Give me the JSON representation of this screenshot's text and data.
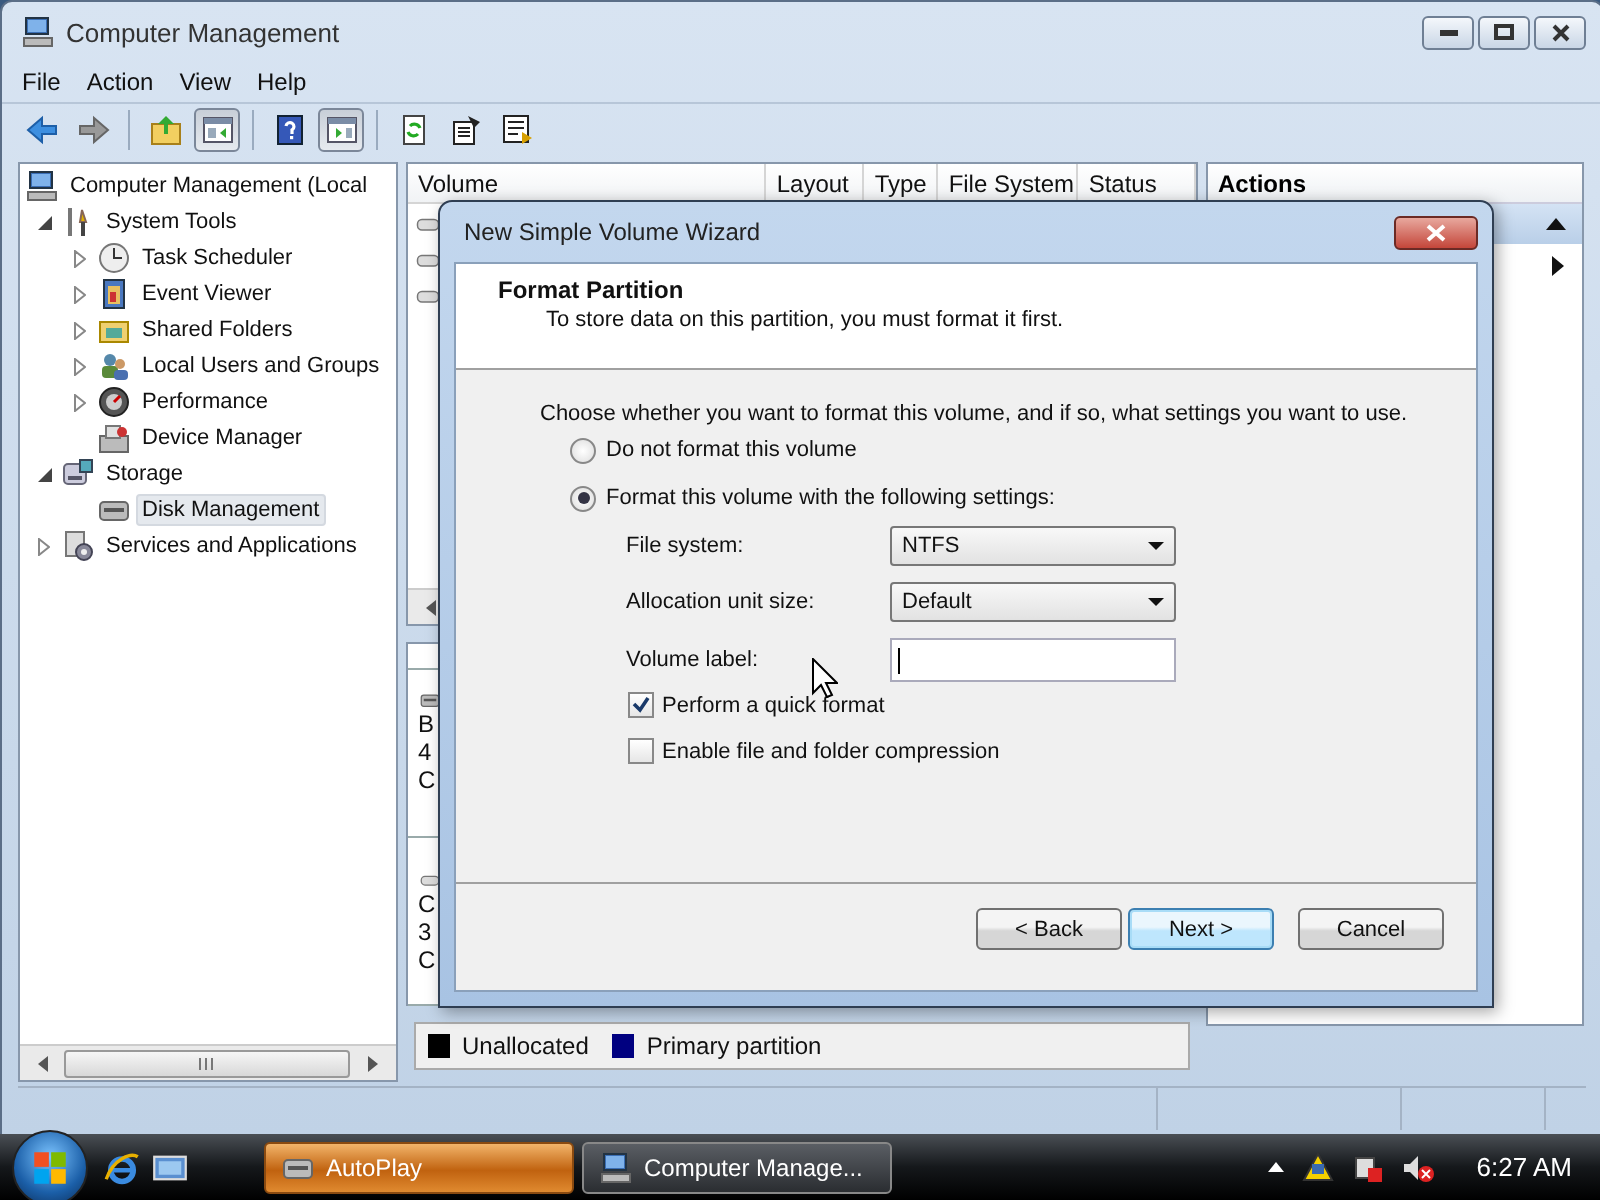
{
  "window": {
    "title": "Computer Management"
  },
  "menu": [
    "File",
    "Action",
    "View",
    "Help"
  ],
  "toolbar": [
    [
      {
        "kind": "back",
        "pressed": false
      },
      {
        "kind": "forward",
        "pressed": false
      }
    ],
    [
      {
        "kind": "up",
        "pressed": false
      },
      {
        "kind": "tree",
        "pressed": true
      }
    ],
    [
      {
        "kind": "help",
        "pressed": false
      },
      {
        "kind": "panel",
        "pressed": true
      }
    ],
    [
      {
        "kind": "refresh",
        "pressed": false
      },
      {
        "kind": "properties",
        "pressed": false
      },
      {
        "kind": "export",
        "pressed": false
      }
    ]
  ],
  "tree": [
    {
      "label": "Computer Management (Local",
      "kind": "leaf",
      "selected": false,
      "children": [
        {
          "label": "System Tools",
          "kind": "branch",
          "expanded": true,
          "selected": false,
          "children": [
            {
              "label": "Task Scheduler",
              "kind": "branch",
              "expanded": false,
              "selected": false
            },
            {
              "label": "Event Viewer",
              "kind": "branch",
              "expanded": false,
              "selected": false
            },
            {
              "label": "Shared Folders",
              "kind": "branch",
              "expanded": false,
              "selected": false
            },
            {
              "label": "Local Users and Groups",
              "kind": "branch",
              "expanded": false,
              "selected": false
            },
            {
              "label": "Performance",
              "kind": "branch",
              "expanded": false,
              "selected": false
            },
            {
              "label": "Device Manager",
              "kind": "leaf",
              "selected": false
            }
          ]
        },
        {
          "label": "Storage",
          "kind": "branch",
          "expanded": true,
          "selected": false,
          "children": [
            {
              "label": "Disk Management",
              "kind": "leaf",
              "selected": true
            }
          ]
        },
        {
          "label": "Services and Applications",
          "kind": "branch",
          "expanded": false,
          "selected": false
        }
      ]
    }
  ],
  "volume_list": {
    "columns": [
      "Volume",
      "Layout",
      "Type",
      "File System",
      "Status"
    ]
  },
  "disks": [
    {
      "lines": [
        "B",
        "4",
        "C"
      ]
    },
    {
      "lines": [
        "C",
        "3",
        "C"
      ]
    }
  ],
  "legend": [
    {
      "label": "Unallocated",
      "color": "#000000"
    },
    {
      "label": "Primary partition",
      "color": "#000080"
    }
  ],
  "actions": {
    "title": "Actions"
  },
  "dialog": {
    "title": "New Simple Volume Wizard",
    "heading": "Format Partition",
    "subheading": "To store data on this partition, you must format it first.",
    "instruction": "Choose whether you want to format this volume, and if so, what settings you want to use.",
    "options": [
      {
        "label": "Do not format this volume",
        "selected": false
      },
      {
        "label": "Format this volume with the following settings:",
        "selected": true
      }
    ],
    "settings": [
      {
        "kind": "dropdown",
        "label": "File system:",
        "value": "NTFS"
      },
      {
        "kind": "dropdown",
        "label": "Allocation unit size:",
        "value": "Default"
      },
      {
        "kind": "text",
        "label": "Volume label:",
        "focused": true
      }
    ],
    "checkboxes": [
      {
        "label": "Perform a quick format",
        "checked": true
      },
      {
        "label": "Enable file and folder compression",
        "checked": false
      }
    ],
    "buttons": [
      {
        "label": "< Back",
        "default": false
      },
      {
        "label": "Next >",
        "default": true
      },
      {
        "label": "Cancel",
        "default": false
      }
    ]
  },
  "taskbar": {
    "tasks": [
      {
        "label": "AutoPlay",
        "flashing": true,
        "active": false
      },
      {
        "label": "Computer Manage...",
        "flashing": false,
        "active": true
      }
    ],
    "clock": "6:27 AM"
  }
}
